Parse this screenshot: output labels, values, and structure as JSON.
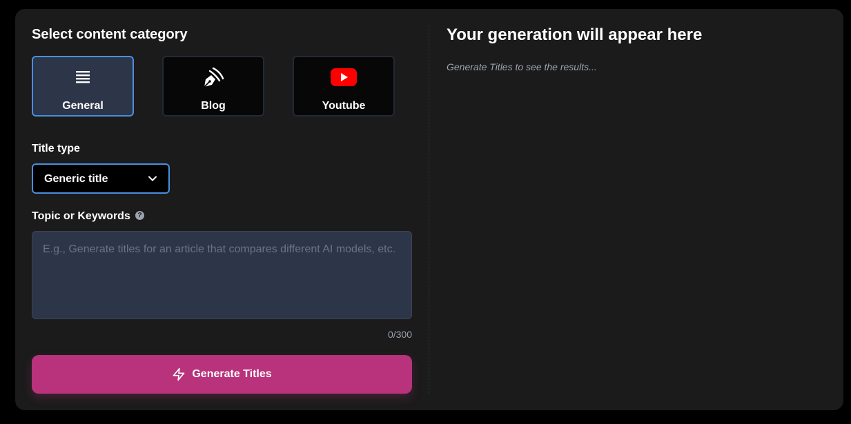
{
  "form": {
    "heading": "Select content category",
    "categories": [
      {
        "label": "General",
        "icon": "list-icon",
        "selected": true
      },
      {
        "label": "Blog",
        "icon": "pen-nib-icon",
        "selected": false
      },
      {
        "label": "Youtube",
        "icon": "youtube-icon",
        "selected": false
      }
    ],
    "title_type_label": "Title type",
    "title_type_value": "Generic title",
    "topic_label": "Topic or Keywords",
    "topic_placeholder": "E.g., Generate titles for an article that compares different AI models, etc.",
    "topic_value": "",
    "char_counter": "0/300",
    "generate_button_label": "Generate Titles"
  },
  "output": {
    "title": "Your generation will appear here",
    "placeholder": "Generate Titles to see the results..."
  },
  "colors": {
    "accent_blue": "#4a8fe0",
    "generate_button": "#b8327c",
    "youtube_red": "#ff0000",
    "panel_bg": "#1b1b1b"
  }
}
